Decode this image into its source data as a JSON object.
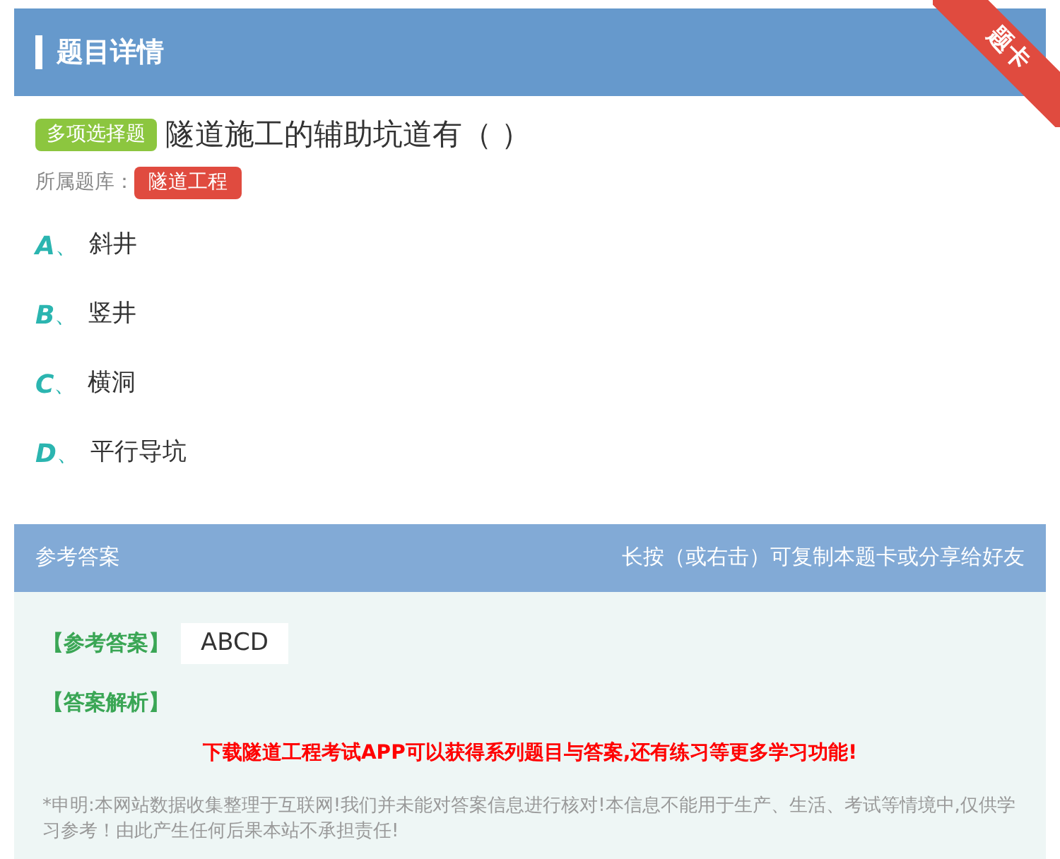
{
  "header": {
    "title": "题目详情",
    "ribbon": "题卡"
  },
  "question": {
    "type_badge": "多项选择题",
    "text": "隧道施工的辅助坑道有（ ）",
    "bank_label": "所属题库：",
    "bank": "隧道工程"
  },
  "options": [
    {
      "letter": "A",
      "separator": "、",
      "text": "斜井"
    },
    {
      "letter": "B",
      "separator": "、",
      "text": "竖井"
    },
    {
      "letter": "C",
      "separator": "、",
      "text": "横洞"
    },
    {
      "letter": "D",
      "separator": "、",
      "text": "平行导坑"
    }
  ],
  "answer": {
    "title": "参考答案",
    "hint": "长按（或右击）可复制本题卡或分享给好友",
    "answer_label": "【参考答案】",
    "answer_value": "ABCD",
    "analysis_label": "【答案解析】",
    "promo": "下载隧道工程考试APP可以获得系列题目与答案,还有练习等更多学习功能!",
    "disclaimer": "*申明:本网站数据收集整理于互联网!我们并未能对答案信息进行核对!本信息不能用于生产、生活、考试等情境中,仅供学习参考！由此产生任何后果本站不承担责任!"
  }
}
